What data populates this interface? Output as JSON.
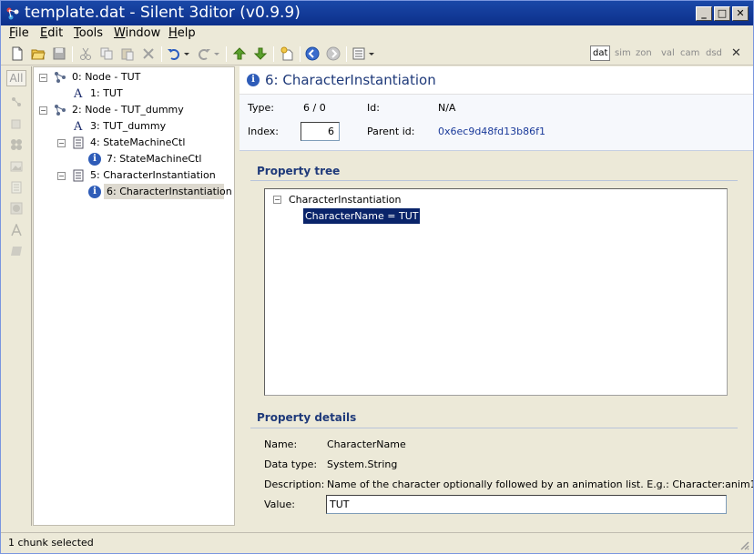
{
  "window": {
    "title": "template.dat - Silent 3ditor (v0.9.9)",
    "minimize": "_",
    "maximize": "□",
    "close": "✕"
  },
  "menu": {
    "file": {
      "u": "F",
      "rest": "ile"
    },
    "edit": {
      "u": "E",
      "rest": "dit"
    },
    "tools": {
      "u": "T",
      "rest": "ools"
    },
    "window": {
      "u": "W",
      "rest": "indow"
    },
    "help": {
      "u": "H",
      "rest": "elp"
    }
  },
  "toolbar": {
    "modes": [
      "dat",
      "sim",
      "zon",
      "val",
      "cam",
      "dsd"
    ],
    "active_mode": "dat",
    "close_glyph": "✕"
  },
  "strip": {
    "all_label": "All"
  },
  "tree": {
    "items": [
      {
        "label": "0: Node - TUT",
        "type": "node",
        "expander": "−"
      },
      {
        "label": "1: TUT",
        "type": "text"
      },
      {
        "label": "2: Node - TUT_dummy",
        "type": "node",
        "expander": "−"
      },
      {
        "label": "3: TUT_dummy",
        "type": "text"
      },
      {
        "label": "4: StateMachineCtl",
        "type": "doc",
        "expander": "−"
      },
      {
        "label": "7: StateMachineCtl",
        "type": "info"
      },
      {
        "label": "5: CharacterInstantiation",
        "type": "doc",
        "expander": "−"
      },
      {
        "label": "6: CharacterInstantiation",
        "type": "info",
        "selected": true
      }
    ]
  },
  "detail": {
    "header_title": "6: CharacterInstantiation",
    "type_label": "Type:",
    "type_value": "6 / 0",
    "id_label": "Id:",
    "id_value": "N/A",
    "index_label": "Index:",
    "index_value": "6",
    "parent_label": "Parent id:",
    "parent_value": "0x6ec9d48fd13b86f1",
    "property_tree_title": "Property tree",
    "ptree_root": "CharacterInstantiation",
    "ptree_child": "CharacterName = TUT",
    "property_details_title": "Property details",
    "name_label": "Name:",
    "name_value": "CharacterName",
    "datatype_label": "Data type:",
    "datatype_value": "System.String",
    "description_label": "Description:",
    "description_value": "Name of the character optionally followed by an animation list. E.g.: Character:anim1,",
    "value_label": "Value:",
    "value_value": "TUT"
  },
  "status": {
    "text": "1 chunk selected"
  },
  "colors": {
    "titlebar": "#0c2f8a",
    "accent_text": "#1f3a7a",
    "selection": "#0a246a",
    "parent_id": "#1a3a9a"
  }
}
